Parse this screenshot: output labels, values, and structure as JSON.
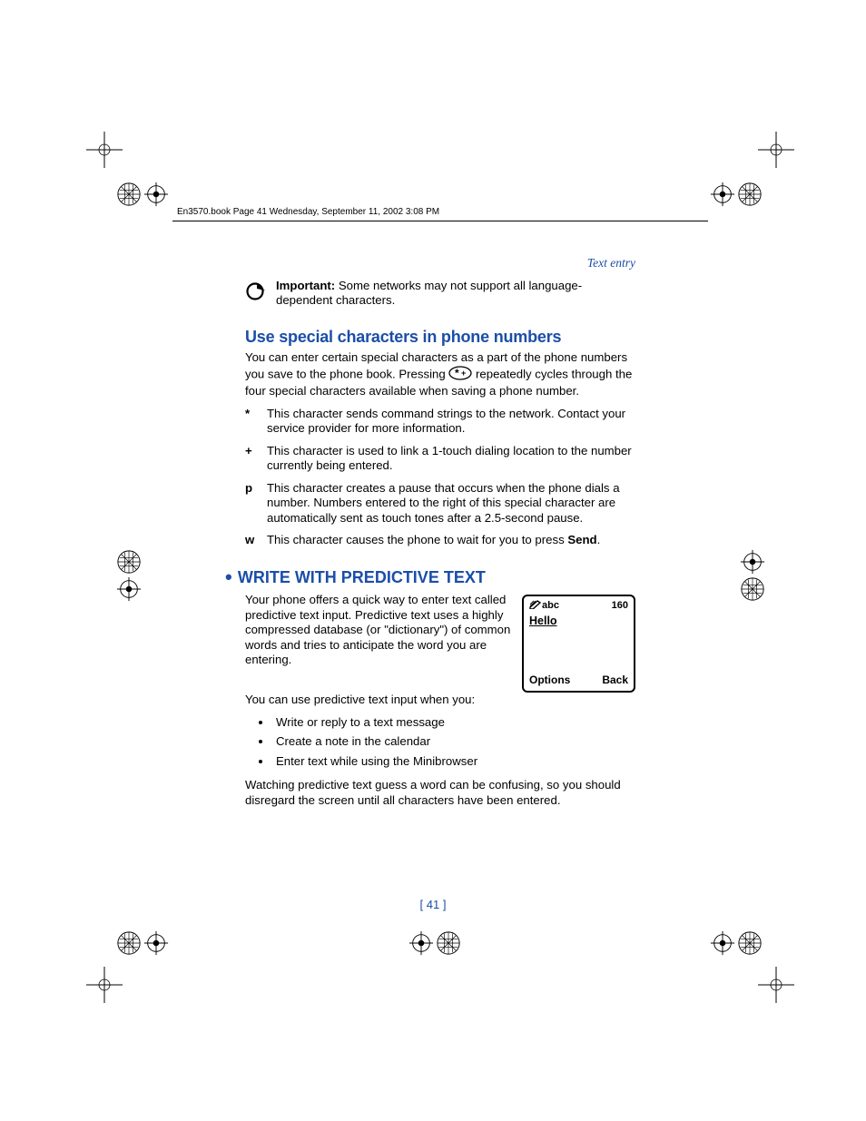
{
  "header_line": "En3570.book  Page 41  Wednesday, September 11, 2002  3:08 PM",
  "section_label": "Text entry",
  "important_label": "Important:",
  "important_text": " Some networks may not support all language-dependent characters.",
  "h2_special": "Use special characters in phone numbers",
  "p_special_1a": "You can enter certain special characters as a part of the phone numbers you save to the phone book. Pressing ",
  "p_special_1b": " repeatedly cycles through the four special characters available when saving a phone number.",
  "chars": [
    {
      "sym": "*",
      "desc": "This character sends command strings to the network. Contact your service provider for more information."
    },
    {
      "sym": "+",
      "desc": "This character is used to link a 1-touch dialing location to the number currently being entered."
    },
    {
      "sym": "p",
      "desc": "This character creates a pause that occurs when the phone dials a number. Numbers entered to the right of this special character are automatically sent as touch tones after a 2.5-second pause."
    },
    {
      "sym": "w",
      "desc_pre": "This character causes the phone to wait for you to press ",
      "desc_bold": "Send",
      "desc_post": "."
    }
  ],
  "h2_predict": "WRITE WITH PREDICTIVE TEXT",
  "p_predict_1": "Your phone offers a quick way to enter text called predictive text input. Predictive text uses a highly compressed database (or \"dictionary\") of common words and tries to anticipate the word you are entering.",
  "phone": {
    "mode": "abc",
    "count": "160",
    "text": "Hello",
    "left": "Options",
    "right": "Back"
  },
  "p_predict_2": "You can use predictive text input when you:",
  "bullets": [
    "Write or reply to a text message",
    "Create a note in the calendar",
    "Enter text while using the Minibrowser"
  ],
  "p_predict_3": "Watching predictive text guess a word can be confusing, so you should disregard the screen until all characters have been entered.",
  "page_num": "[ 41 ]"
}
